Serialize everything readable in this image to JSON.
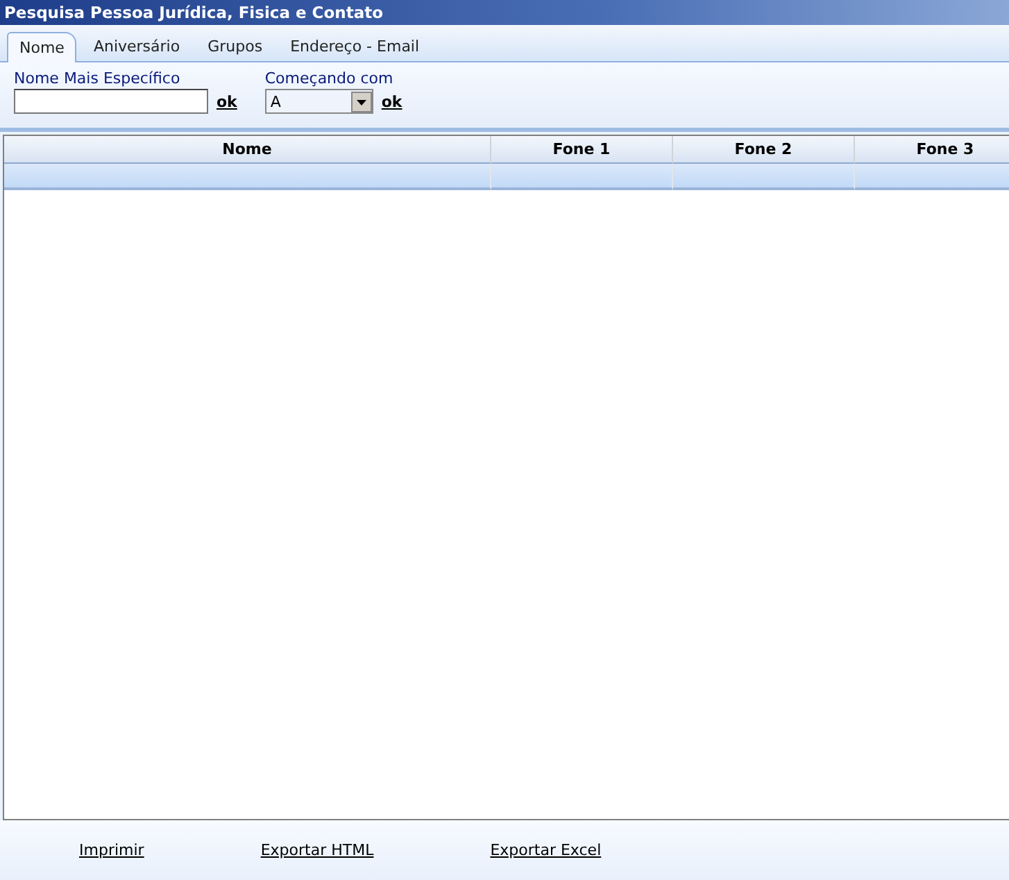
{
  "window": {
    "title": "Pesquisa Pessoa Jurídica, Fisica e Contato"
  },
  "tabs": [
    {
      "label": "Nome",
      "selected": true
    },
    {
      "label": "Aniversário",
      "selected": false
    },
    {
      "label": "Grupos",
      "selected": false
    },
    {
      "label": "Endereço - Email",
      "selected": false
    }
  ],
  "filters": {
    "name_label": "Nome Mais Específico",
    "name_ok": "ok",
    "start_label": "Começando com",
    "start_value": "A",
    "start_ok": "ok"
  },
  "table": {
    "columns": [
      "Nome",
      "Fone 1",
      "Fone 2",
      "Fone 3"
    ],
    "rows": [
      {
        "selected": true
      }
    ]
  },
  "footer": [
    "Imprimir",
    "Exportar HTML",
    "Exportar Excel"
  ]
}
